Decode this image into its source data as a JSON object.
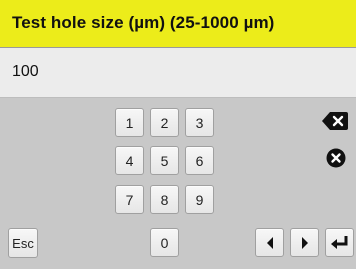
{
  "dialog": {
    "title": "Test hole size (µm) (25-1000 µm)",
    "value": "100"
  },
  "keypad": {
    "digits": [
      "1",
      "2",
      "3",
      "4",
      "5",
      "6",
      "7",
      "8",
      "9",
      "0"
    ]
  },
  "buttons": {
    "esc_label": "Esc"
  },
  "icons": {
    "backspace": "backspace-icon",
    "clear": "clear-icon",
    "left": "arrow-left-icon",
    "right": "arrow-right-icon",
    "enter": "enter-icon"
  },
  "colors": {
    "title_bg": "#ecec1a",
    "body_bg": "#c8c8c8",
    "field_bg": "#ececec"
  }
}
